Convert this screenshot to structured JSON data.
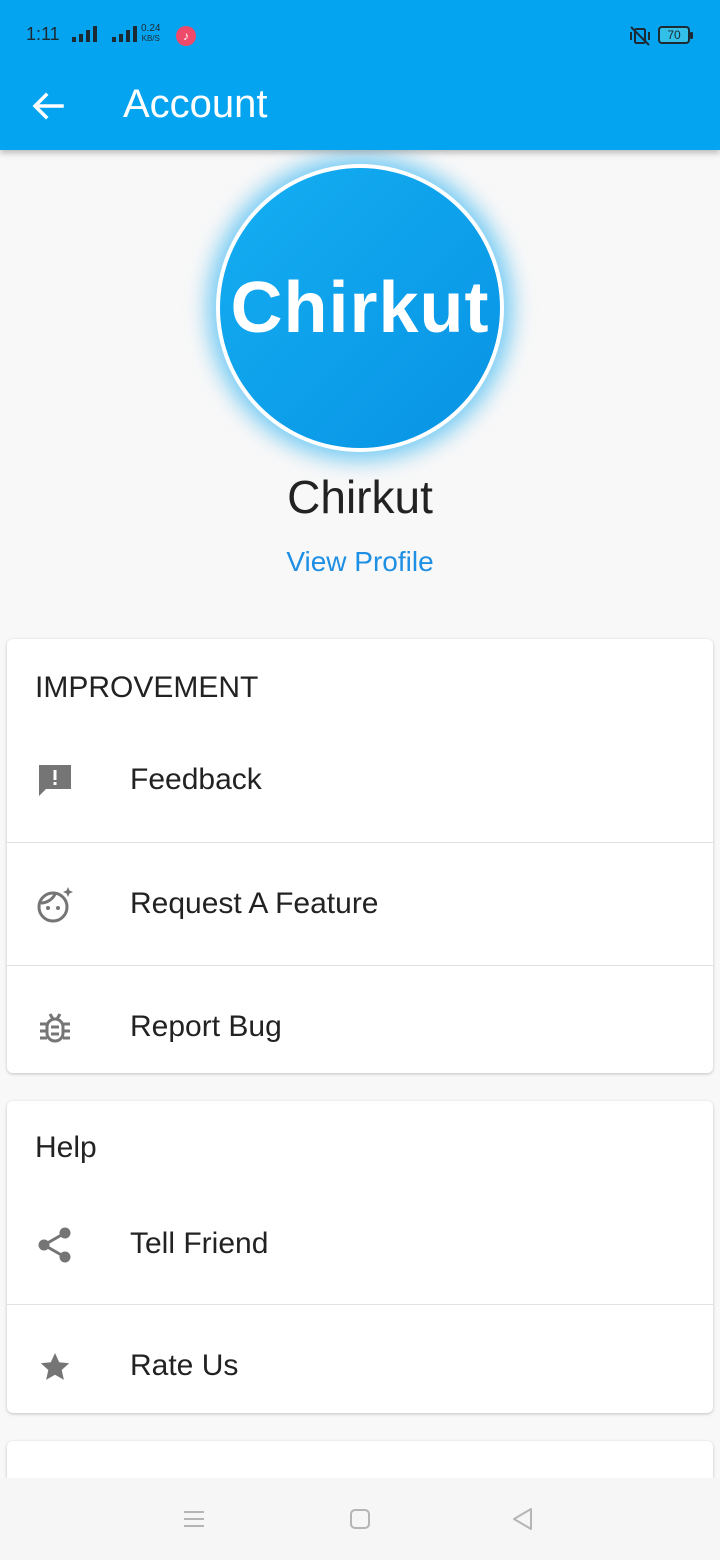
{
  "status_bar": {
    "time": "1:11",
    "speed_value": "0.24",
    "speed_unit": "KB/S",
    "battery": "70"
  },
  "app_bar": {
    "title": "Account"
  },
  "profile": {
    "avatar_text": "Chirkut",
    "name": "Chirkut",
    "view_profile_label": "View Profile"
  },
  "sections": {
    "improvement": {
      "title": "IMPROVEMENT",
      "items": [
        {
          "label": "Feedback",
          "icon": "feedback-icon"
        },
        {
          "label": "Request A Feature",
          "icon": "face-sparkle-icon"
        },
        {
          "label": "Report Bug",
          "icon": "bug-icon"
        }
      ]
    },
    "help": {
      "title": "Help",
      "items": [
        {
          "label": "Tell Friend",
          "icon": "share-icon"
        },
        {
          "label": "Rate Us",
          "icon": "star-icon"
        }
      ]
    }
  },
  "colors": {
    "primary": "#04a4f0",
    "link": "#1e8fe3",
    "icon": "#757575"
  }
}
